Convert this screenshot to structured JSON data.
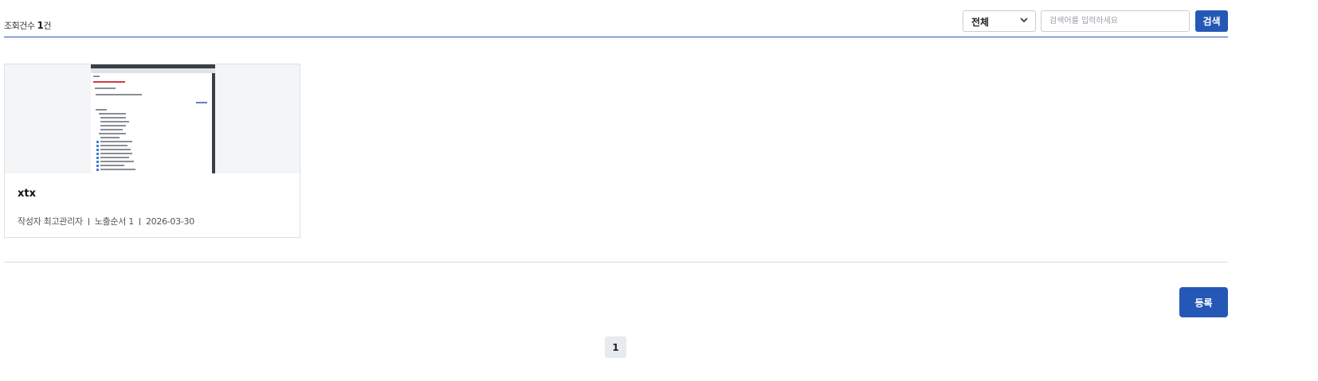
{
  "header": {
    "count_label": "조회건수",
    "count_value": "1",
    "count_unit": "건"
  },
  "search": {
    "select_value": "전체",
    "placeholder": "검색어를 입력하세요",
    "button_label": "검색"
  },
  "cards": [
    {
      "title": "xtx",
      "author_label": "작성자",
      "author": "최고관리자",
      "order_label": "노출순서",
      "order": "1",
      "date": "2026-03-30"
    }
  ],
  "actions": {
    "register_label": "등록"
  },
  "pagination": {
    "current_page": "1"
  },
  "colors": {
    "primary": "#2557b7",
    "border": "#dcdfe4",
    "thumb_bg": "#f4f5f7"
  }
}
